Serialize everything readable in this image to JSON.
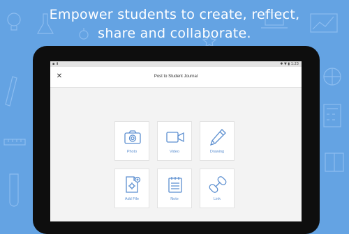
{
  "headline": {
    "line1": "Empower students to create, reflect,",
    "line2": "share and collaborate."
  },
  "status_bar": {
    "left": "▪ ⬇",
    "right": "✱ ▼ ▮ 1:23"
  },
  "app_bar": {
    "close_symbol": "✕",
    "title": "Post to Student Journal"
  },
  "options": [
    {
      "label": "Photo",
      "icon": "camera-icon"
    },
    {
      "label": "Video",
      "icon": "video-camera-icon"
    },
    {
      "label": "Drawing",
      "icon": "pencil-icon"
    },
    {
      "label": "Add File",
      "icon": "file-icon"
    },
    {
      "label": "Note",
      "icon": "notepad-icon"
    },
    {
      "label": "Link",
      "icon": "link-icon"
    }
  ],
  "colors": {
    "background": "#64a3e3",
    "icon_blue": "#5c8fd0",
    "tablet_bezel": "#0e0e0e",
    "screen_bg": "#f3f3f3"
  }
}
